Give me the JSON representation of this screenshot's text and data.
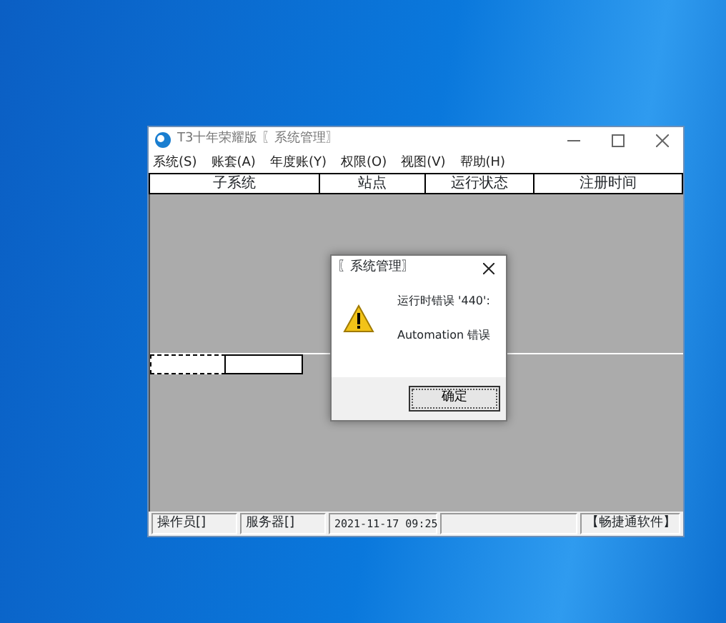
{
  "window": {
    "title": "T3十年荣耀版 〖系统管理〗"
  },
  "menu": [
    "系统(S)",
    "账套(A)",
    "年度账(Y)",
    "权限(O)",
    "视图(V)",
    "帮助(H)"
  ],
  "table": {
    "columns": [
      "子系统",
      "站点",
      "运行状态",
      "注册时间"
    ]
  },
  "status_bar": [
    "操作员[]",
    "服务器[]",
    "2021-11-17 09:25",
    "【畅捷通软件】"
  ],
  "dialog": {
    "title": "〖系统管理〗",
    "lines": [
      "运行时错误 '440':",
      "Automation 错误"
    ],
    "button": "确定"
  }
}
